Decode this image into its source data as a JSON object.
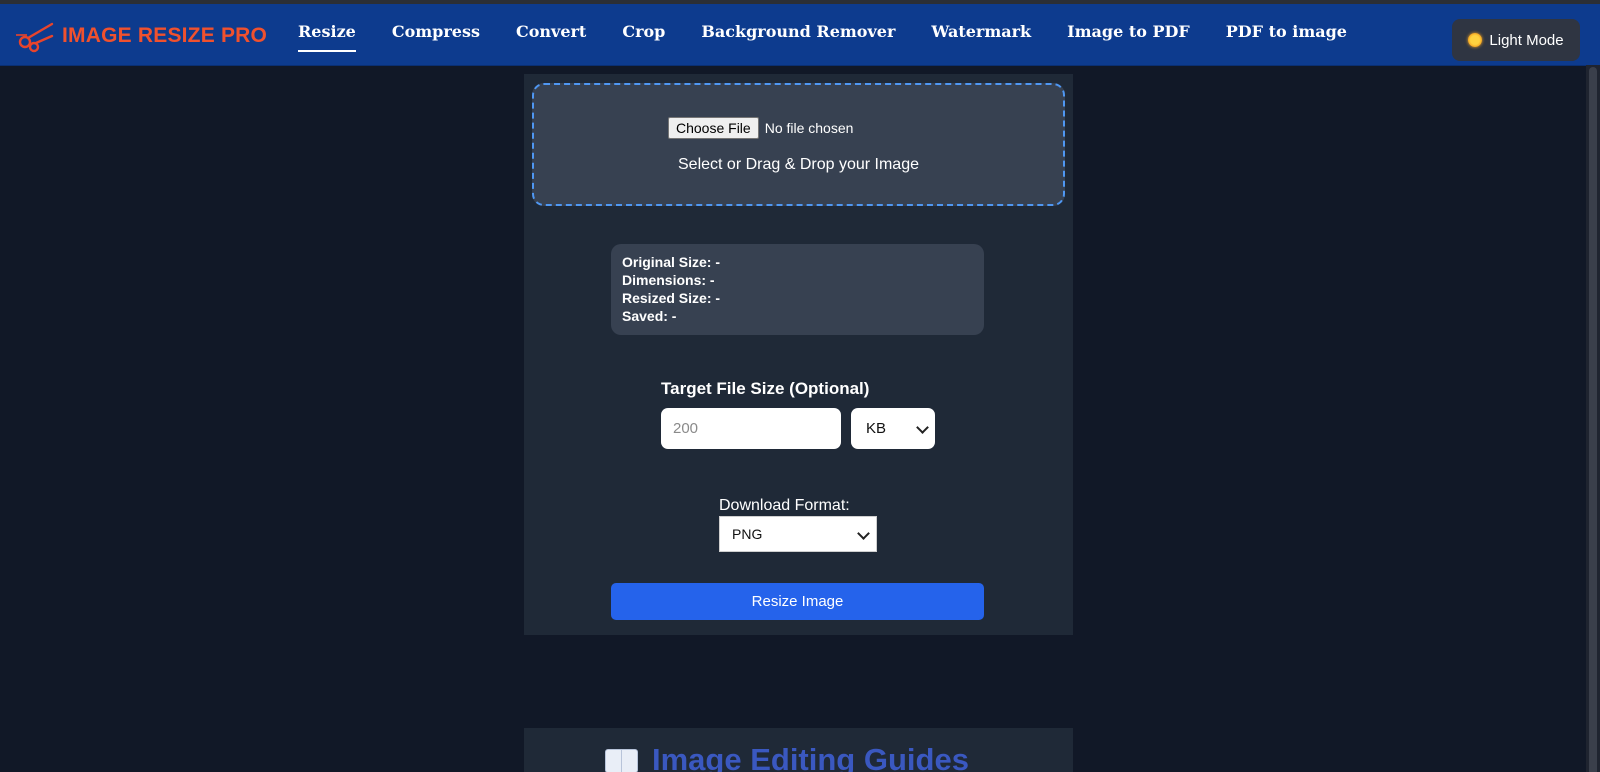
{
  "header": {
    "logo_text": "IMAGE RESIZE PRO",
    "nav": [
      {
        "label": "Resize",
        "active": true
      },
      {
        "label": "Compress",
        "active": false
      },
      {
        "label": "Convert",
        "active": false
      },
      {
        "label": "Crop",
        "active": false
      },
      {
        "label": "Background Remover",
        "active": false
      },
      {
        "label": "Watermark",
        "active": false
      },
      {
        "label": "Image to PDF",
        "active": false
      },
      {
        "label": "PDF to image",
        "active": false
      }
    ],
    "mode_button": "Light Mode"
  },
  "upload": {
    "choose_file_label": "Choose File",
    "file_status": "No file chosen",
    "instruction": "Select or Drag & Drop your Image"
  },
  "info": {
    "original_size": "Original Size: -",
    "dimensions": "Dimensions: -",
    "resized_size": "Resized Size: -",
    "saved": "Saved: -"
  },
  "target": {
    "label": "Target File Size (Optional)",
    "placeholder": "200",
    "unit": "KB"
  },
  "format": {
    "label": "Download Format:",
    "selected": "PNG"
  },
  "action": {
    "resize_label": "Resize Image"
  },
  "guides": {
    "title": "Image Editing Guides"
  },
  "colors": {
    "navbar": "#0d3b8e",
    "logo": "#f0512e",
    "page_bg": "#111827",
    "card_bg": "#1f2937",
    "panel_bg": "#374151",
    "primary_button": "#2563eb",
    "dropzone_border": "#4f97f2"
  },
  "icons": {
    "logo": "scissors-icon",
    "mode": "sun-icon",
    "guides": "open-book-icon"
  }
}
